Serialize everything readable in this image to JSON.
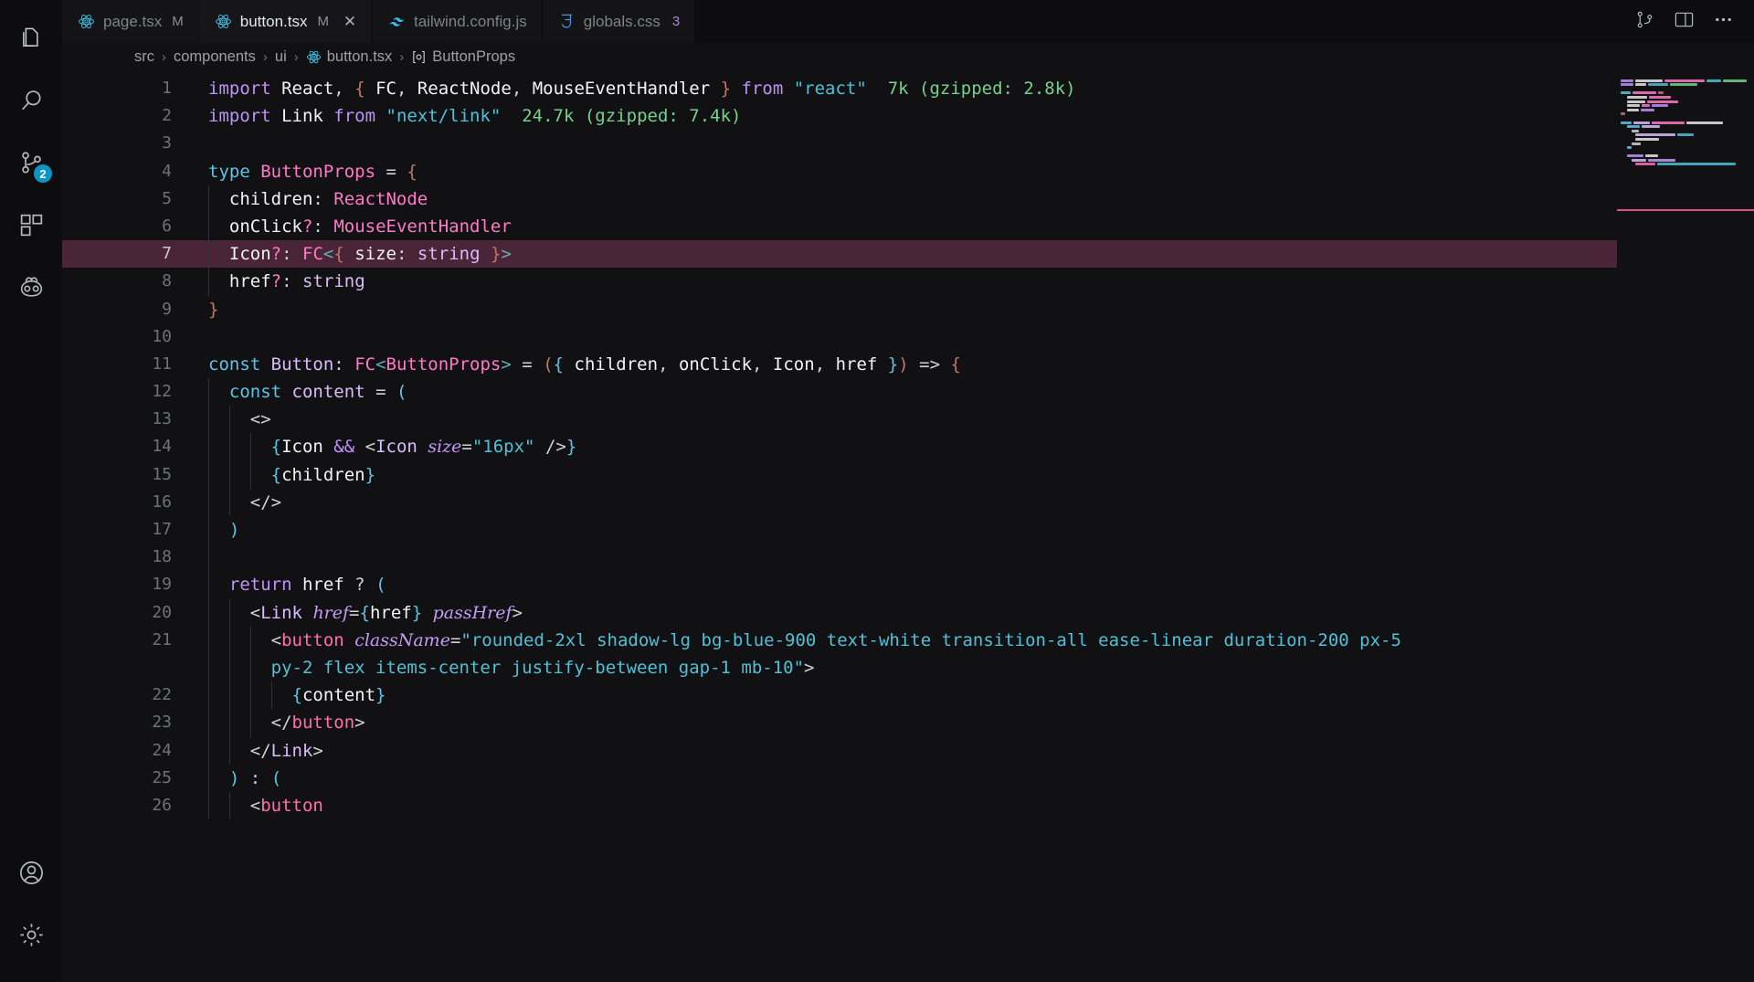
{
  "activitybar": {
    "items": [
      {
        "name": "explorer",
        "icon": "files-icon",
        "badge": null
      },
      {
        "name": "search",
        "icon": "search-icon",
        "badge": null
      },
      {
        "name": "source-control",
        "icon": "source-control-icon",
        "badge": "2"
      },
      {
        "name": "extensions",
        "icon": "extensions-icon",
        "badge": null
      },
      {
        "name": "copilot",
        "icon": "copilot-icon",
        "badge": null
      }
    ],
    "bottom": [
      {
        "name": "accounts",
        "icon": "account-icon"
      },
      {
        "name": "manage",
        "icon": "gear-icon"
      }
    ]
  },
  "tabs": [
    {
      "label": "page.tsx",
      "icon": "react-icon",
      "dirty": "M",
      "active": false,
      "closable": false,
      "count": null
    },
    {
      "label": "button.tsx",
      "icon": "react-icon",
      "dirty": "M",
      "active": true,
      "closable": true,
      "close_label": "✕",
      "count": null
    },
    {
      "label": "tailwind.config.js",
      "icon": "tailwind-icon",
      "dirty": null,
      "active": false,
      "closable": false,
      "count": null
    },
    {
      "label": "globals.css",
      "icon": "css-icon",
      "dirty": null,
      "active": false,
      "closable": false,
      "count": "3"
    }
  ],
  "tabbar_actions": [
    {
      "name": "split-editor-vertical-button",
      "icon": "split-editor-icon"
    },
    {
      "name": "toggle-panel-button",
      "icon": "layout-panel-icon"
    },
    {
      "name": "more-actions-button",
      "icon": "ellipsis-icon"
    }
  ],
  "breadcrumbs": [
    {
      "label": "src",
      "icon": null
    },
    {
      "label": "components",
      "icon": null
    },
    {
      "label": "ui",
      "icon": null
    },
    {
      "label": "button.tsx",
      "icon": "react-icon"
    },
    {
      "label": "ButtonProps",
      "icon": "symbol-interface-icon"
    }
  ],
  "breadcrumb_separator": "›",
  "editor": {
    "language": "typescriptreact",
    "selected_line": 7,
    "lightbulb_line": 6,
    "import_costs": [
      {
        "line": 1,
        "text": "7k (gzipped: 2.8k)"
      },
      {
        "line": 2,
        "text": "24.7k (gzipped: 7.4k)"
      }
    ],
    "lines": [
      {
        "n": "1",
        "text": "import React, { FC, ReactNode, MouseEventHandler } from \"react\"  7k (gzipped: 2.8k)"
      },
      {
        "n": "2",
        "text": "import Link from \"next/link\"  24.7k (gzipped: 7.4k)"
      },
      {
        "n": "3",
        "text": ""
      },
      {
        "n": "4",
        "text": "type ButtonProps = {"
      },
      {
        "n": "5",
        "text": "  children: ReactNode"
      },
      {
        "n": "6",
        "text": "  onClick?: MouseEventHandler"
      },
      {
        "n": "7",
        "text": "  Icon?: FC<{ size: string }>"
      },
      {
        "n": "8",
        "text": "  href?: string"
      },
      {
        "n": "9",
        "text": "}"
      },
      {
        "n": "10",
        "text": ""
      },
      {
        "n": "11",
        "text": "const Button: FC<ButtonProps> = ({ children, onClick, Icon, href }) => {"
      },
      {
        "n": "12",
        "text": "  const content = ("
      },
      {
        "n": "13",
        "text": "    <>"
      },
      {
        "n": "14",
        "text": "      {Icon && <Icon size=\"16px\" />}"
      },
      {
        "n": "15",
        "text": "      {children}"
      },
      {
        "n": "16",
        "text": "    </>"
      },
      {
        "n": "17",
        "text": "  )"
      },
      {
        "n": "18",
        "text": ""
      },
      {
        "n": "19",
        "text": "  return href ? ("
      },
      {
        "n": "20",
        "text": "    <Link href={href} passHref>"
      },
      {
        "n": "21",
        "text": "      <button className=\"rounded-2xl shadow-lg bg-blue-900 text-white transition-all ease-linear duration-200 px-5 py-2 flex items-center justify-between gap-1 mb-10\">"
      },
      {
        "n": "22",
        "text": "        {content}"
      },
      {
        "n": "23",
        "text": "      </button>"
      },
      {
        "n": "24",
        "text": "    </Link>"
      },
      {
        "n": "25",
        "text": "  ) : ("
      },
      {
        "n": "26",
        "text": "    <button"
      }
    ]
  },
  "colors": {
    "editor_bg": "#111114",
    "activitybar_bg": "#0d0d0f",
    "tab_active_bg": "#16161a",
    "selection_bg": "#4a2537",
    "badge_bg": "#0a95c4",
    "keyword": "#bd93f9",
    "type": "#ff79c6",
    "string": "#4fc1d6",
    "comment": "#76d18c",
    "variable": "#d9bdfb",
    "minimap_marker": "#d6518a"
  }
}
